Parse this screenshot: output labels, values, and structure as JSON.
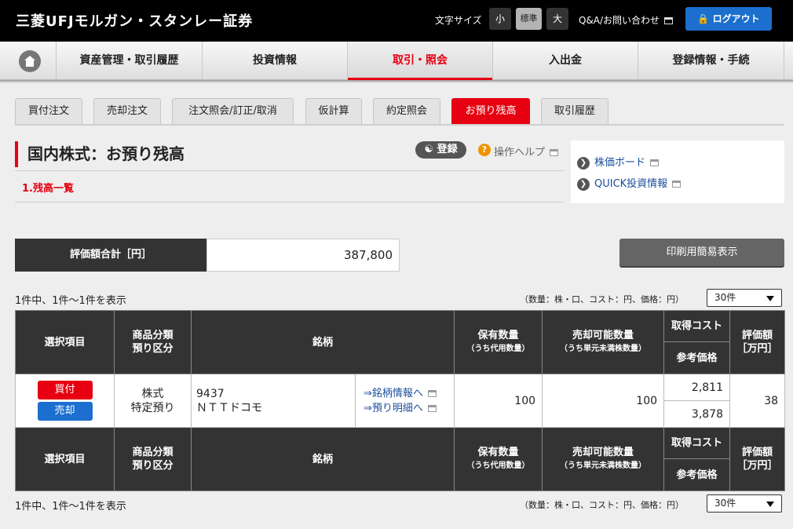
{
  "header": {
    "logo": "三菱UFJモルガン・スタンレー証券",
    "font_size_label": "文字サイズ",
    "font_size_small": "小",
    "font_size_normal": "標準",
    "font_size_large": "大",
    "qa_link": "Q&A/お問い合わせ",
    "logout": "ログアウト"
  },
  "global_nav": {
    "home_icon": "home-icon",
    "items": [
      "資産管理・取引履歴",
      "投資情報",
      "取引・照会",
      "入出金",
      "登録情報・手続"
    ]
  },
  "tabs": [
    "買付注文",
    "売却注文",
    "注文照会/訂正/取消",
    "仮計算",
    "約定照会",
    "お預り残高",
    "取引履歴"
  ],
  "page": {
    "title": "国内株式：お預り残高",
    "section_title": "1.残高一覧",
    "register_button": "登録",
    "help_link": "操作ヘルプ"
  },
  "side_links": [
    "株価ボード",
    "QUICK投資情報"
  ],
  "summary": {
    "total_label": "評価額合計［円］",
    "total_value": "387,800",
    "print_button": "印刷用簡易表示"
  },
  "list_info": {
    "count_text": "1件中、1件〜1件を表示",
    "unit_note": "（数量：株・口、コスト：円、価格：円）",
    "per_page": "30件"
  },
  "table": {
    "headers": {
      "select": "選択項目",
      "category_line1": "商品分類",
      "category_line2": "預り区分",
      "security": "銘柄",
      "holding_qty": "保有数量",
      "holding_qty_sub": "（うち代用数量）",
      "sellable_qty": "売却可能数量",
      "sellable_qty_sub": "（うち単元未満株数量）",
      "acq_cost": "取得コスト",
      "ref_price": "参考価格",
      "valuation_line1": "評価額",
      "valuation_line2": "［万円］"
    },
    "rows": [
      {
        "buy": "買付",
        "sell": "売却",
        "category": "株式",
        "account": "特定預り",
        "code": "9437",
        "name": "ＮＴＴドコモ",
        "info_link": "⇒銘柄情報へ",
        "detail_link": "⇒預り明細へ",
        "holding_qty": "100",
        "sellable_qty": "100",
        "acq_cost": "2,811",
        "ref_price": "3,878",
        "valuation": "38"
      }
    ]
  },
  "colors": {
    "accent_red": "#e60012",
    "accent_blue": "#1c6fce",
    "header_bg": "#000000",
    "table_header_bg": "#333333"
  }
}
